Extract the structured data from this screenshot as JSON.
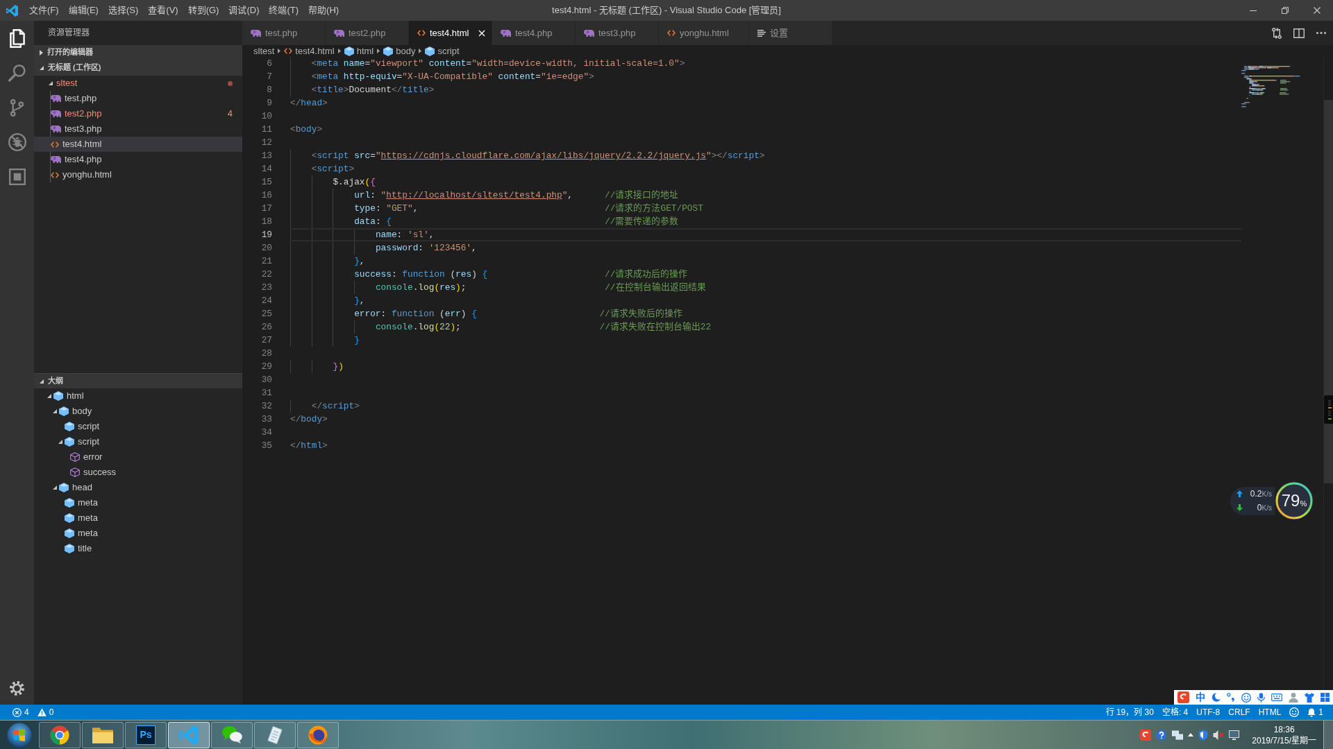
{
  "title_bar": {
    "menu": [
      "文件(F)",
      "编辑(E)",
      "选择(S)",
      "查看(V)",
      "转到(G)",
      "调试(D)",
      "终端(T)",
      "帮助(H)"
    ],
    "title": "test4.html - 无标题 (工作区) - Visual Studio Code [管理员]"
  },
  "activity_bar": {
    "items": [
      {
        "kind": "explorer",
        "selected": true
      },
      {
        "kind": "search",
        "selected": false
      },
      {
        "kind": "scm",
        "selected": false
      },
      {
        "kind": "debug",
        "selected": false
      },
      {
        "kind": "extensions",
        "selected": false
      }
    ]
  },
  "sidebar": {
    "title": "资源管理器",
    "sections": [
      {
        "title": "打开的编辑器",
        "kind": "files",
        "expanded": false
      },
      {
        "title": "无标题 (工作区)",
        "kind": "files",
        "expanded": true,
        "tree": [
          {
            "label": "sltest",
            "kind": "folder",
            "expanded": true,
            "errors": true,
            "selected": false,
            "children": [
              {
                "label": "test.php",
                "kind": "php",
                "errors": false,
                "selected": false
              },
              {
                "label": "test2.php",
                "kind": "php",
                "errors": true,
                "badge": "4",
                "selected": false
              },
              {
                "label": "test3.php",
                "kind": "php",
                "errors": false,
                "selected": false
              },
              {
                "label": "test4.html",
                "kind": "html",
                "errors": false,
                "selected": true
              },
              {
                "label": "test4.php",
                "kind": "php",
                "errors": false,
                "selected": false
              },
              {
                "label": "yonghu.html",
                "kind": "html",
                "errors": false,
                "selected": false
              }
            ]
          }
        ]
      },
      {
        "title": "大纲",
        "kind": "outline",
        "expanded": true,
        "tree": [
          {
            "label": "html",
            "kind": "element",
            "expanded": true,
            "children": [
              {
                "label": "body",
                "kind": "element",
                "expanded": true,
                "children": [
                  {
                    "label": "script",
                    "kind": "element"
                  },
                  {
                    "label": "script",
                    "kind": "element",
                    "expanded": true,
                    "children": [
                      {
                        "label": "error",
                        "kind": "property"
                      },
                      {
                        "label": "success",
                        "kind": "property"
                      }
                    ]
                  }
                ]
              },
              {
                "label": "head",
                "kind": "element",
                "expanded": true,
                "children": [
                  {
                    "label": "meta",
                    "kind": "element"
                  },
                  {
                    "label": "meta",
                    "kind": "element"
                  },
                  {
                    "label": "meta",
                    "kind": "element"
                  },
                  {
                    "label": "title",
                    "kind": "element"
                  }
                ]
              }
            ]
          }
        ]
      }
    ]
  },
  "editor": {
    "tabs": [
      {
        "label": "test.php",
        "kind": "php",
        "selected": false
      },
      {
        "label": "test2.php",
        "kind": "php",
        "selected": false
      },
      {
        "label": "test4.html",
        "kind": "html",
        "selected": true
      },
      {
        "label": "test4.php",
        "kind": "php",
        "selected": false
      },
      {
        "label": "test3.php",
        "kind": "php",
        "selected": false
      },
      {
        "label": "yonghu.html",
        "kind": "html",
        "selected": false
      },
      {
        "label": "设置",
        "kind": "settings",
        "selected": false
      }
    ],
    "breadcrumbs": [
      {
        "label": "sltest",
        "kind": "folder"
      },
      {
        "label": "test4.html",
        "kind": "html"
      },
      {
        "label": "html",
        "kind": "element"
      },
      {
        "label": "body",
        "kind": "element"
      },
      {
        "label": "script",
        "kind": "element"
      }
    ],
    "lines": [
      {
        "number": "6",
        "current": false,
        "tokens": [
          {
            "kind": "punct",
            "text": "    <"
          },
          {
            "kind": "tag",
            "text": "meta"
          },
          {
            "kind": "attr",
            "text": " name"
          },
          {
            "kind": "op",
            "text": "="
          },
          {
            "kind": "str",
            "text": "\"viewport\""
          },
          {
            "kind": "attr",
            "text": " content"
          },
          {
            "kind": "op",
            "text": "="
          },
          {
            "kind": "str",
            "text": "\"width=device-width, initial-scale=1.0\""
          },
          {
            "kind": "punct",
            "text": ">"
          }
        ]
      },
      {
        "number": "7",
        "current": false,
        "tokens": [
          {
            "kind": "punct",
            "text": "    <"
          },
          {
            "kind": "tag",
            "text": "meta"
          },
          {
            "kind": "attr",
            "text": " http-equiv"
          },
          {
            "kind": "op",
            "text": "="
          },
          {
            "kind": "str",
            "text": "\"X-UA-Compatible\""
          },
          {
            "kind": "attr",
            "text": " content"
          },
          {
            "kind": "op",
            "text": "="
          },
          {
            "kind": "str",
            "text": "\"ie=edge\""
          },
          {
            "kind": "punct",
            "text": ">"
          }
        ]
      },
      {
        "number": "8",
        "current": false,
        "tokens": [
          {
            "kind": "punct",
            "text": "    <"
          },
          {
            "kind": "tag",
            "text": "title"
          },
          {
            "kind": "punct",
            "text": ">"
          },
          {
            "kind": "text",
            "text": "Document"
          },
          {
            "kind": "punct",
            "text": "</"
          },
          {
            "kind": "tag",
            "text": "title"
          },
          {
            "kind": "punct",
            "text": ">"
          }
        ]
      },
      {
        "number": "9",
        "current": false,
        "tokens": [
          {
            "kind": "punct",
            "text": "</"
          },
          {
            "kind": "tag",
            "text": "head"
          },
          {
            "kind": "punct",
            "text": ">"
          }
        ]
      },
      {
        "number": "10",
        "current": false
      },
      {
        "number": "11",
        "current": false,
        "tokens": [
          {
            "kind": "punct",
            "text": "<"
          },
          {
            "kind": "tag",
            "text": "body"
          },
          {
            "kind": "punct",
            "text": ">"
          }
        ]
      },
      {
        "number": "12",
        "current": false
      },
      {
        "number": "13",
        "current": false,
        "tokens": [
          {
            "kind": "punct",
            "text": "    <"
          },
          {
            "kind": "tag",
            "text": "script"
          },
          {
            "kind": "attr",
            "text": " src"
          },
          {
            "kind": "op",
            "text": "="
          },
          {
            "kind": "str",
            "text": "\""
          },
          {
            "kind": "link",
            "text": "https://cdnjs.cloudflare.com/ajax/libs/jquery/2.2.2/jquery.js"
          },
          {
            "kind": "str",
            "text": "\""
          },
          {
            "kind": "punct",
            "text": "></"
          },
          {
            "kind": "tag",
            "text": "script"
          },
          {
            "kind": "punct",
            "text": ">"
          }
        ]
      },
      {
        "number": "14",
        "current": false,
        "tokens": [
          {
            "kind": "punct",
            "text": "    <"
          },
          {
            "kind": "tag",
            "text": "script"
          },
          {
            "kind": "punct",
            "text": ">"
          }
        ]
      },
      {
        "number": "15",
        "current": false,
        "tokens": [
          {
            "kind": "text",
            "text": "        $.ajax"
          },
          {
            "kind": "b1",
            "text": "("
          },
          {
            "kind": "b2",
            "text": "{"
          }
        ]
      },
      {
        "number": "16",
        "current": false,
        "tokens": [
          {
            "kind": "prop",
            "text": "            url"
          },
          {
            "kind": "text",
            "text": ": "
          },
          {
            "kind": "str",
            "text": "\""
          },
          {
            "kind": "link",
            "text": "http://localhost/sltest/test4.php"
          },
          {
            "kind": "str",
            "text": "\""
          },
          {
            "kind": "text",
            "text": ","
          },
          {
            "kind": "comment",
            "text": "      //请求接口的地址"
          }
        ]
      },
      {
        "number": "17",
        "current": false,
        "tokens": [
          {
            "kind": "prop",
            "text": "            type"
          },
          {
            "kind": "text",
            "text": ": "
          },
          {
            "kind": "str",
            "text": "\"GET\""
          },
          {
            "kind": "text",
            "text": ","
          },
          {
            "kind": "comment",
            "text": "                                   //请求的方法GET/POST"
          }
        ]
      },
      {
        "number": "18",
        "current": false,
        "tokens": [
          {
            "kind": "prop",
            "text": "            data"
          },
          {
            "kind": "text",
            "text": ": "
          },
          {
            "kind": "b3",
            "text": "{"
          },
          {
            "kind": "comment",
            "text": "                                        //需要传递的参数"
          }
        ]
      },
      {
        "number": "19",
        "current": true,
        "tokens": [
          {
            "kind": "prop",
            "text": "                name"
          },
          {
            "kind": "text",
            "text": ": "
          },
          {
            "kind": "str",
            "text": "'sl'"
          },
          {
            "kind": "text",
            "text": ","
          }
        ]
      },
      {
        "number": "20",
        "current": false,
        "tokens": [
          {
            "kind": "prop",
            "text": "                password"
          },
          {
            "kind": "text",
            "text": ": "
          },
          {
            "kind": "str",
            "text": "'123456'"
          },
          {
            "kind": "text",
            "text": ","
          }
        ]
      },
      {
        "number": "21",
        "current": false,
        "tokens": [
          {
            "kind": "b3",
            "text": "            }"
          },
          {
            "kind": "text",
            "text": ","
          }
        ]
      },
      {
        "number": "22",
        "current": false,
        "tokens": [
          {
            "kind": "prop",
            "text": "            success"
          },
          {
            "kind": "text",
            "text": ": "
          },
          {
            "kind": "kw",
            "text": "function"
          },
          {
            "kind": "text",
            "text": " ("
          },
          {
            "kind": "param",
            "text": "res"
          },
          {
            "kind": "text",
            "text": ") "
          },
          {
            "kind": "b3",
            "text": "{"
          },
          {
            "kind": "comment",
            "text": "                      //请求成功后的操作"
          }
        ]
      },
      {
        "number": "23",
        "current": false,
        "tokens": [
          {
            "kind": "cls",
            "text": "                console"
          },
          {
            "kind": "text",
            "text": "."
          },
          {
            "kind": "func",
            "text": "log"
          },
          {
            "kind": "b1",
            "text": "("
          },
          {
            "kind": "param",
            "text": "res"
          },
          {
            "kind": "b1",
            "text": ")"
          },
          {
            "kind": "text",
            "text": ";"
          },
          {
            "kind": "comment",
            "text": "                          //在控制台输出返回结果"
          }
        ]
      },
      {
        "number": "24",
        "current": false,
        "tokens": [
          {
            "kind": "b3",
            "text": "            }"
          },
          {
            "kind": "text",
            "text": ","
          }
        ]
      },
      {
        "number": "25",
        "current": false,
        "tokens": [
          {
            "kind": "prop",
            "text": "            error"
          },
          {
            "kind": "text",
            "text": ": "
          },
          {
            "kind": "kw",
            "text": "function"
          },
          {
            "kind": "text",
            "text": " ("
          },
          {
            "kind": "param",
            "text": "err"
          },
          {
            "kind": "text",
            "text": ") "
          },
          {
            "kind": "b3",
            "text": "{"
          },
          {
            "kind": "comment",
            "text": "                       //请求失败后的操作"
          }
        ]
      },
      {
        "number": "26",
        "current": false,
        "tokens": [
          {
            "kind": "cls",
            "text": "                console"
          },
          {
            "kind": "text",
            "text": "."
          },
          {
            "kind": "func",
            "text": "log"
          },
          {
            "kind": "b1",
            "text": "("
          },
          {
            "kind": "num",
            "text": "22"
          },
          {
            "kind": "b1",
            "text": ")"
          },
          {
            "kind": "text",
            "text": ";"
          },
          {
            "kind": "comment",
            "text": "                          //请求失败在控制台输出22"
          }
        ]
      },
      {
        "number": "27",
        "current": false,
        "tokens": [
          {
            "kind": "b3",
            "text": "            }"
          }
        ]
      },
      {
        "number": "28",
        "current": false
      },
      {
        "number": "29",
        "current": false,
        "tokens": [
          {
            "kind": "b2",
            "text": "        }"
          },
          {
            "kind": "b1",
            "text": ")"
          }
        ]
      },
      {
        "number": "30",
        "current": false
      },
      {
        "number": "31",
        "current": false
      },
      {
        "number": "32",
        "current": false,
        "tokens": [
          {
            "kind": "punct",
            "text": "    </"
          },
          {
            "kind": "tag",
            "text": "script"
          },
          {
            "kind": "punct",
            "text": ">"
          }
        ]
      },
      {
        "number": "33",
        "current": false,
        "tokens": [
          {
            "kind": "punct",
            "text": "</"
          },
          {
            "kind": "tag",
            "text": "body"
          },
          {
            "kind": "punct",
            "text": ">"
          }
        ]
      },
      {
        "number": "34",
        "current": false
      },
      {
        "number": "35",
        "current": false,
        "tokens": [
          {
            "kind": "punct",
            "text": "</"
          },
          {
            "kind": "tag",
            "text": "html"
          },
          {
            "kind": "punct",
            "text": ">"
          }
        ]
      }
    ]
  },
  "net_widget": {
    "upload": {
      "value": "0.2",
      "unit": "K/s"
    },
    "download": {
      "value": "0",
      "unit": "K/s"
    },
    "memory": {
      "value": "79",
      "unit": "%"
    }
  },
  "ime_toolbar": {
    "mode": "中"
  },
  "status_bar": {
    "errors": "4",
    "warnings": "0",
    "items": [
      "行 19，列 30",
      "空格: 4",
      "UTF-8",
      "CRLF",
      "HTML"
    ],
    "notifications": "1"
  },
  "taskbar": {
    "apps": [
      {
        "kind": "chrome",
        "active": false
      },
      {
        "kind": "explorer",
        "active": false
      },
      {
        "kind": "photoshop",
        "label": "Ps",
        "active": false
      },
      {
        "kind": "vscode",
        "active": true
      },
      {
        "kind": "wechat",
        "active": false
      },
      {
        "kind": "notepad",
        "active": false
      },
      {
        "kind": "firefox",
        "active": false
      }
    ],
    "tray": [
      {
        "kind": "sogou"
      },
      {
        "kind": "help"
      },
      {
        "kind": "network"
      },
      {
        "kind": "overflow"
      },
      {
        "kind": "shield"
      },
      {
        "kind": "volume",
        "muted": true
      },
      {
        "kind": "display"
      }
    ],
    "time": "18:36",
    "date": "2019/7/15/星期一"
  }
}
